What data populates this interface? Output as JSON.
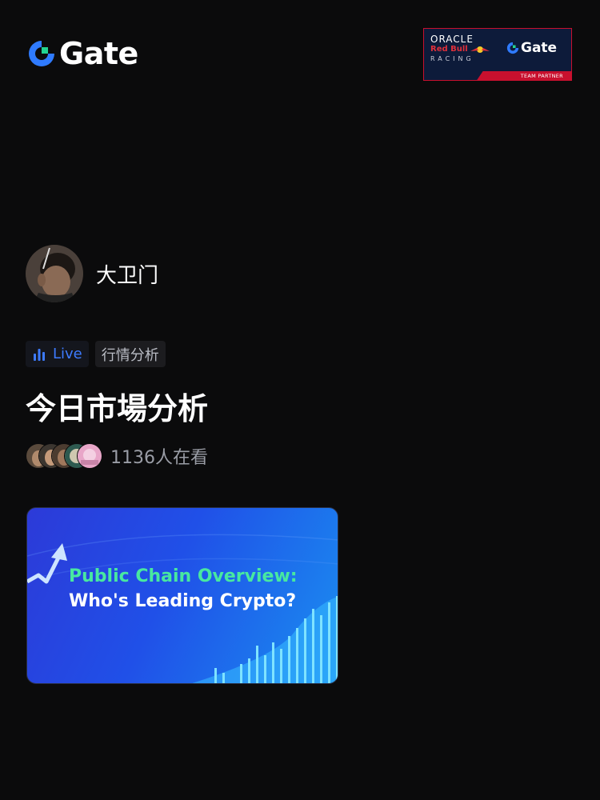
{
  "brand": {
    "name": "Gate",
    "accent_color": "#2f7bff",
    "highlight_color": "#22d391"
  },
  "partner_badge": {
    "oracle": "ORACLE",
    "redbull": "Red Bull",
    "racing": "RACING",
    "gate": "Gate",
    "strip": "TEAM PARTNER"
  },
  "host": {
    "name": "大卫门",
    "avatar_icon": "host-avatar"
  },
  "tags": {
    "live": "Live",
    "category": "行情分析"
  },
  "stream": {
    "title": "今日市場分析",
    "viewer_count": "1136人在看"
  },
  "banner": {
    "line1": "Public Chain Overview:",
    "line2": "Who's Leading Crypto?"
  }
}
